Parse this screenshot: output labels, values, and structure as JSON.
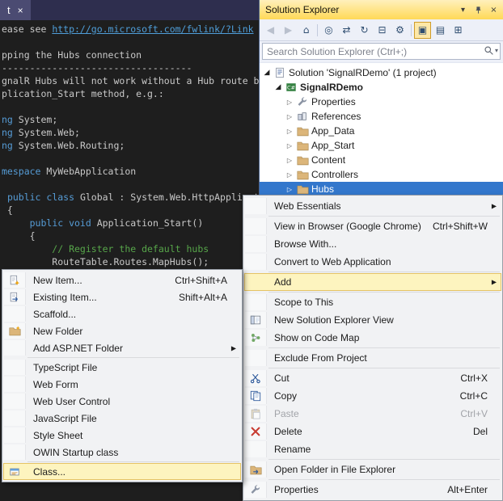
{
  "colors": {
    "selection_blue": "#3377cc",
    "menu_highlight": "#fdf4bf",
    "titlebar_gold": "#ffd957",
    "editor_bg": "#1e1e1e",
    "keyword_blue": "#569cd6",
    "comment_green": "#57a64a"
  },
  "editor": {
    "tab": {
      "label": "t",
      "close_glyph": "×"
    },
    "code_lines": [
      {
        "seg": [
          [
            "ease see ",
            "plain"
          ],
          [
            "http://go.microsoft.com/fwlink/?Link",
            "link"
          ]
        ]
      },
      {
        "seg": []
      },
      {
        "seg": [
          [
            "pping the Hubs connection",
            "plain"
          ]
        ]
      },
      {
        "seg": [
          [
            "----------------------------------",
            "plain"
          ]
        ]
      },
      {
        "seg": [
          [
            "gnalR Hubs will not work without a Hub route b",
            "plain"
          ]
        ]
      },
      {
        "seg": [
          [
            "plication_Start method, e.g.:",
            "plain"
          ]
        ]
      },
      {
        "seg": []
      },
      {
        "seg": [
          [
            "ng",
            "kw"
          ],
          [
            " System;",
            "plain"
          ]
        ]
      },
      {
        "seg": [
          [
            "ng",
            "kw"
          ],
          [
            " System.Web;",
            "plain"
          ]
        ]
      },
      {
        "seg": [
          [
            "ng",
            "kw"
          ],
          [
            " System.Web.Routing;",
            "plain"
          ]
        ]
      },
      {
        "seg": []
      },
      {
        "seg": [
          [
            "mespace",
            "kw"
          ],
          [
            " MyWebApplication",
            "plain"
          ]
        ]
      },
      {
        "seg": []
      },
      {
        "seg": [
          [
            " ",
            "plain"
          ],
          [
            "public class",
            "kw"
          ],
          [
            " Global : System.Web.HttpApplication",
            "plain"
          ]
        ]
      },
      {
        "seg": [
          [
            " {",
            "plain"
          ]
        ]
      },
      {
        "seg": [
          [
            "     ",
            "plain"
          ],
          [
            "public void",
            "kw"
          ],
          [
            " Application_Start()",
            "plain"
          ]
        ]
      },
      {
        "seg": [
          [
            "     {",
            "plain"
          ]
        ]
      },
      {
        "seg": [
          [
            "         // Register the default hubs",
            "comment"
          ]
        ]
      },
      {
        "seg": [
          [
            "         RouteTable.Routes.MapHubs();",
            "plain"
          ]
        ]
      }
    ]
  },
  "solution_explorer": {
    "title": "Solution Explorer",
    "titlebar_icons": [
      {
        "name": "window-position",
        "glyph": "▾"
      },
      {
        "name": "pin",
        "icon": "pin"
      },
      {
        "name": "close",
        "glyph": "×"
      }
    ],
    "toolbar": [
      {
        "name": "back-button",
        "glyph": "◀",
        "disabled": true
      },
      {
        "name": "forward-button",
        "glyph": "▶",
        "disabled": true
      },
      {
        "name": "home-button",
        "glyph": "⌂"
      },
      {
        "type": "separator"
      },
      {
        "name": "sync-selection-button",
        "glyph": "◎"
      },
      {
        "name": "sync-with-active-document-button",
        "glyph": "⇄"
      },
      {
        "name": "refresh-button",
        "glyph": "↻"
      },
      {
        "name": "collapse-all-button",
        "glyph": "⊟"
      },
      {
        "name": "properties-window-button",
        "glyph": "⚙"
      },
      {
        "type": "separator"
      },
      {
        "name": "preview-selected-items-toggle",
        "glyph": "▣",
        "active": true
      },
      {
        "name": "show-all-files-toggle",
        "glyph": "▤"
      },
      {
        "name": "view-code-map-button",
        "glyph": "⊞"
      }
    ],
    "search": {
      "placeholder": "Search Solution Explorer (Ctrl+;)"
    },
    "tree": [
      {
        "label": "Solution 'SignalRDemo' (1 project)",
        "level": 0,
        "expander": "expanded",
        "icon": "solution"
      },
      {
        "label": "SignalRDemo",
        "level": 1,
        "expander": "expanded",
        "icon": "csproj",
        "bold": true
      },
      {
        "label": "Properties",
        "level": 2,
        "expander": "collapsed",
        "icon": "wrench"
      },
      {
        "label": "References",
        "level": 2,
        "expander": "collapsed",
        "icon": "references"
      },
      {
        "label": "App_Data",
        "level": 2,
        "expander": "collapsed",
        "icon": "folder"
      },
      {
        "label": "App_Start",
        "level": 2,
        "expander": "collapsed",
        "icon": "folder"
      },
      {
        "label": "Content",
        "level": 2,
        "expander": "collapsed",
        "icon": "folder"
      },
      {
        "label": "Controllers",
        "level": 2,
        "expander": "collapsed",
        "icon": "folder"
      },
      {
        "label": "Hubs",
        "level": 2,
        "expander": "collapsed",
        "icon": "folder",
        "selected": true
      }
    ]
  },
  "context_menu": {
    "items": [
      {
        "label": "Web Essentials",
        "submenu": true
      },
      {
        "type": "separator"
      },
      {
        "label": "View in Browser (Google Chrome)",
        "shortcut": "Ctrl+Shift+W"
      },
      {
        "label": "Browse With..."
      },
      {
        "label": "Convert to Web Application"
      },
      {
        "type": "separator"
      },
      {
        "label": "Add",
        "submenu": true,
        "highlighted": true
      },
      {
        "type": "separator"
      },
      {
        "label": "Scope to This"
      },
      {
        "label": "New Solution Explorer View",
        "icon": "seview"
      },
      {
        "label": "Show on Code Map",
        "icon": "codemap"
      },
      {
        "type": "separator"
      },
      {
        "label": "Exclude From Project"
      },
      {
        "type": "separator"
      },
      {
        "label": "Cut",
        "shortcut": "Ctrl+X",
        "icon": "scissors"
      },
      {
        "label": "Copy",
        "shortcut": "Ctrl+C",
        "icon": "copy"
      },
      {
        "label": "Paste",
        "shortcut": "Ctrl+V",
        "icon": "paste",
        "disabled": true
      },
      {
        "label": "Delete",
        "shortcut": "Del",
        "icon": "delete"
      },
      {
        "label": "Rename"
      },
      {
        "type": "separator"
      },
      {
        "label": "Open Folder in File Explorer",
        "icon": "openfolder"
      },
      {
        "type": "separator"
      },
      {
        "label": "Properties",
        "shortcut": "Alt+Enter",
        "icon": "wrench"
      }
    ]
  },
  "add_submenu": {
    "items": [
      {
        "label": "New Item...",
        "shortcut": "Ctrl+Shift+A",
        "icon": "newitem"
      },
      {
        "label": "Existing Item...",
        "shortcut": "Shift+Alt+A",
        "icon": "existingitem"
      },
      {
        "label": "Scaffold..."
      },
      {
        "label": "New Folder",
        "icon": "newfolder"
      },
      {
        "label": "Add ASP.NET Folder",
        "submenu": true
      },
      {
        "type": "separator"
      },
      {
        "label": "TypeScript File"
      },
      {
        "label": "Web Form"
      },
      {
        "label": "Web User Control"
      },
      {
        "label": "JavaScript File"
      },
      {
        "label": "Style Sheet"
      },
      {
        "label": "OWIN Startup class"
      },
      {
        "type": "separator"
      },
      {
        "label": "Class...",
        "icon": "class",
        "highlighted": true
      }
    ]
  }
}
